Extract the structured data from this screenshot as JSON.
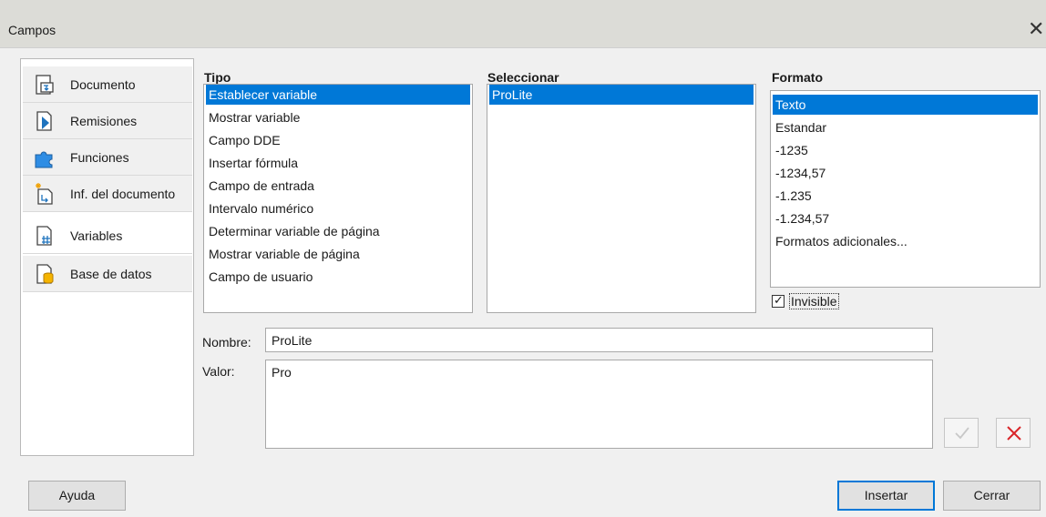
{
  "window": {
    "title": "Campos",
    "close_glyph": "✕"
  },
  "tabs": [
    {
      "label": "Documento",
      "icon": "document-field-icon"
    },
    {
      "label": "Remisiones",
      "icon": "cross-reference-icon"
    },
    {
      "label": "Funciones",
      "icon": "functions-puzzle-icon"
    },
    {
      "label": "Inf. del documento",
      "icon": "document-info-icon"
    },
    {
      "label": "Variables",
      "icon": "variables-icon",
      "active": true
    },
    {
      "label": "Base de datos",
      "icon": "database-icon"
    }
  ],
  "tipo": {
    "label": "Tipo",
    "items": [
      "Establecer variable",
      "Mostrar variable",
      "Campo DDE",
      "Insertar fórmula",
      "Campo de entrada",
      "Intervalo numérico",
      "Determinar variable de página",
      "Mostrar variable de página",
      "Campo de usuario"
    ],
    "selected": "Establecer variable"
  },
  "seleccionar": {
    "label": "Seleccionar",
    "items": [
      "ProLite"
    ],
    "selected": "ProLite"
  },
  "formato": {
    "label": "Formato",
    "items": [
      "Texto",
      "Estandar",
      "-1235",
      "-1234,57",
      "-1.235",
      "-1.234,57",
      "Formatos adicionales..."
    ],
    "selected": "Texto"
  },
  "invisible": {
    "label": "Invisible",
    "checked": true
  },
  "nombre": {
    "label": "Nombre:",
    "value": "ProLite"
  },
  "valor": {
    "label": "Valor:",
    "value": "Pro"
  },
  "buttons": {
    "help": "Ayuda",
    "insert": "Insertar",
    "close": "Cerrar"
  },
  "colors": {
    "selection": "#0078d7",
    "cancel_red": "#d9262a"
  }
}
